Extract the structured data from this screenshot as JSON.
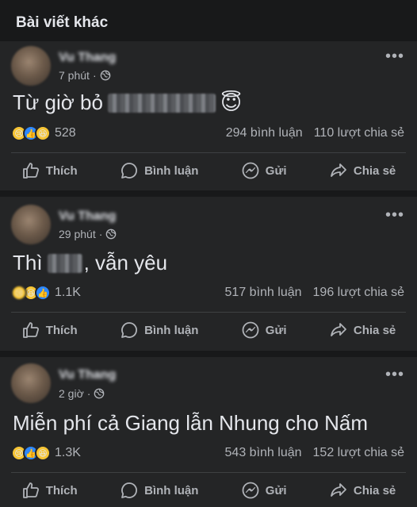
{
  "section": {
    "title": "Bài viết khác"
  },
  "actions": {
    "like": "Thích",
    "comment": "Bình luận",
    "send": "Gửi",
    "share": "Chia sẻ"
  },
  "posts": [
    {
      "author": "Vu Thang",
      "time": "7 phút",
      "dot": "·",
      "text_before": "Từ giờ bỏ",
      "text_after": "😇",
      "reaction_count": "528",
      "comments": "294 bình luận",
      "shares": "110 lượt chia sẻ"
    },
    {
      "author": "Vu Thang",
      "time": "29 phút",
      "dot": "·",
      "text_before": "Thì",
      "text_after": ", vẫn yêu",
      "reaction_count": "1.1K",
      "comments": "517 bình luận",
      "shares": "196 lượt chia sẻ"
    },
    {
      "author": "Vu Thang",
      "time": "2 giờ",
      "dot": "·",
      "text_before": "Miễn phí cả Giang lẫn Nhung cho Nấm",
      "text_after": "",
      "reaction_count": "1.3K",
      "comments": "543 bình luận",
      "shares": "152 lượt chia sẻ"
    }
  ],
  "colors": {
    "background": "#18191a",
    "card": "#242526",
    "text": "#e4e6eb",
    "secondary": "#b0b3b8",
    "like_blue": "#2d88ff",
    "emoji_yellow": "#f7c534"
  },
  "icons": [
    "globe-icon",
    "more-options-icon",
    "like-icon",
    "comment-icon",
    "messenger-icon",
    "share-icon",
    "sad-reaction-icon",
    "like-reaction-icon",
    "haha-reaction-icon"
  ]
}
